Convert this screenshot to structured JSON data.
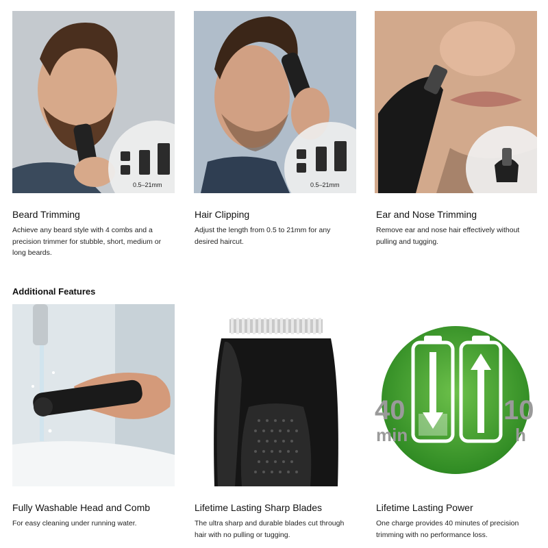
{
  "features": [
    {
      "title": "Beard Trimming",
      "description": "Achieve any beard style with 4 combs and a precision trimmer for stubble, short, medium or long beards.",
      "image_caption": "0.5–21mm"
    },
    {
      "title": "Hair Clipping",
      "description": "Adjust the length from 0.5 to 21mm for any desired haircut.",
      "image_caption": "0.5–21mm"
    },
    {
      "title": "Ear and Nose Trimming",
      "description": "Remove ear and nose hair effectively without pulling and tugging."
    }
  ],
  "additional_heading": "Additional Features",
  "additional": [
    {
      "title": "Fully Washable Head and Comb",
      "description": "For easy cleaning under running water."
    },
    {
      "title": "Lifetime Lasting Sharp Blades",
      "description": "The ultra sharp and durable blades cut through hair with no pulling or tugging."
    },
    {
      "title": "Lifetime Lasting Power",
      "description": "One charge provides 40 minutes of precision trimming with no performance loss.",
      "battery": {
        "run_value": "40",
        "run_unit": "min",
        "charge_value": "10",
        "charge_unit": "h"
      }
    }
  ],
  "colors": {
    "battery_green": "#3f9a2c",
    "number_gray": "#9a9a9a"
  }
}
